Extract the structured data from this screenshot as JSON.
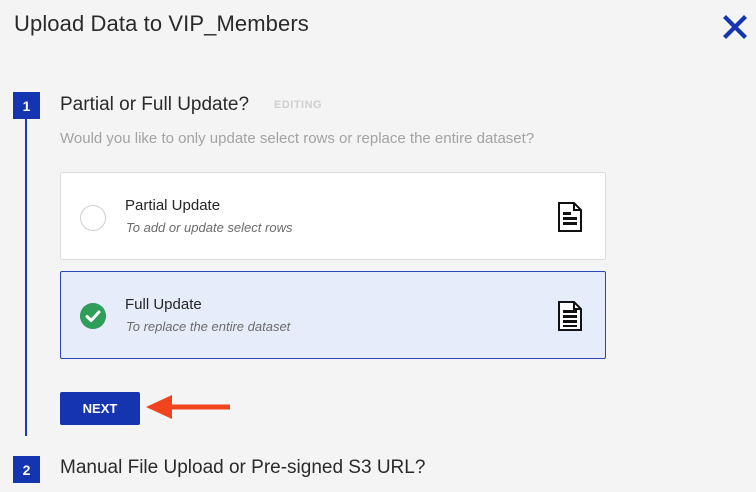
{
  "header": {
    "title": "Upload Data to VIP_Members",
    "close_icon": "close-icon"
  },
  "step1": {
    "number": "1",
    "title": "Partial or Full Update?",
    "status": "EDITING",
    "question": "Would you like to only update select rows or replace the entire dataset?",
    "options": [
      {
        "label": "Partial Update",
        "description": "To add or update select rows",
        "selected": false,
        "icon": "document-icon"
      },
      {
        "label": "Full Update",
        "description": "To replace the entire dataset",
        "selected": true,
        "icon": "document-icon"
      }
    ],
    "next_label": "NEXT"
  },
  "step2": {
    "number": "2",
    "title": "Manual File Upload or Pre-signed S3 URL?"
  },
  "colors": {
    "accent": "#1534b0",
    "selected_bg": "#e7ecfb",
    "check_green": "#2f9e5a",
    "annotation_arrow": "#f0441e"
  }
}
